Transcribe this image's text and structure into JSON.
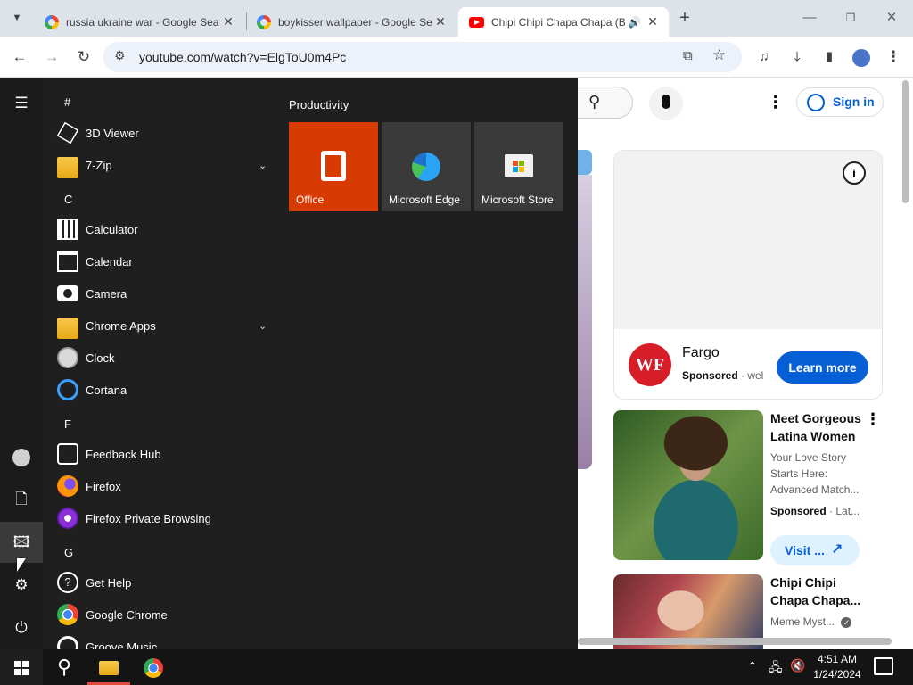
{
  "browser": {
    "tabs": [
      {
        "title": "russia ukraine war - Google Sea",
        "favicon": "google-icon",
        "active": false
      },
      {
        "title": "boykisser wallpaper - Google Se",
        "favicon": "google-icon",
        "active": false
      },
      {
        "title": "Chipi Chipi Chapa Chapa (B",
        "favicon": "youtube-icon",
        "active": true
      }
    ],
    "url": "youtube.com/watch?v=ElgToU0m4Pc"
  },
  "youtube": {
    "sign_in": "Sign in",
    "ad": {
      "brand_logo": "WF",
      "title": "Fargo",
      "sponsored": "Sponsored",
      "sub": "· wel",
      "cta": "Learn more"
    },
    "videos": [
      {
        "title_line1": "Meet Gorgeous",
        "title_line2": "Latina Women",
        "desc_line1": "Your Love Story",
        "desc_line2": "Starts Here:",
        "desc_line3": "Advanced Match...",
        "sponsored": "Sponsored",
        "sub": "· Lat...",
        "cta": "Visit ..."
      },
      {
        "title_line1": "Chipi Chipi",
        "title_line2": "Chapa Chapa...",
        "channel": "Meme Myst..."
      }
    ]
  },
  "start_menu": {
    "apps": [
      {
        "kind": "letter",
        "text": "#"
      },
      {
        "kind": "app",
        "label": "3D Viewer",
        "icon": "cube-icon"
      },
      {
        "kind": "app",
        "label": "7-Zip",
        "icon": "folder-icon",
        "expand": true
      },
      {
        "kind": "letter",
        "text": "C"
      },
      {
        "kind": "app",
        "label": "Calculator",
        "icon": "calculator-icon"
      },
      {
        "kind": "app",
        "label": "Calendar",
        "icon": "calendar-icon"
      },
      {
        "kind": "app",
        "label": "Camera",
        "icon": "camera-icon"
      },
      {
        "kind": "app",
        "label": "Chrome Apps",
        "icon": "folder-icon",
        "expand": true
      },
      {
        "kind": "app",
        "label": "Clock",
        "icon": "clock-icon"
      },
      {
        "kind": "app",
        "label": "Cortana",
        "icon": "cortana-icon"
      },
      {
        "kind": "letter",
        "text": "F"
      },
      {
        "kind": "app",
        "label": "Feedback Hub",
        "icon": "feedback-icon"
      },
      {
        "kind": "app",
        "label": "Firefox",
        "icon": "firefox-icon"
      },
      {
        "kind": "app",
        "label": "Firefox Private Browsing",
        "icon": "firefox-private-icon"
      },
      {
        "kind": "letter",
        "text": "G"
      },
      {
        "kind": "app",
        "label": "Get Help",
        "icon": "help-icon"
      },
      {
        "kind": "app",
        "label": "Google Chrome",
        "icon": "chrome-icon"
      },
      {
        "kind": "app",
        "label": "Groove Music",
        "icon": "music-icon"
      }
    ],
    "group_title": "Productivity",
    "tiles": [
      {
        "label": "Office",
        "icon": "office-icon",
        "color": "#d83b01"
      },
      {
        "label": "Microsoft Edge",
        "icon": "edge-icon",
        "color": "#3a3a3a"
      },
      {
        "label": "Microsoft Store",
        "icon": "store-icon",
        "color": "#3a3a3a"
      }
    ]
  },
  "taskbar": {
    "time": "4:51 AM",
    "date": "1/24/2024"
  }
}
